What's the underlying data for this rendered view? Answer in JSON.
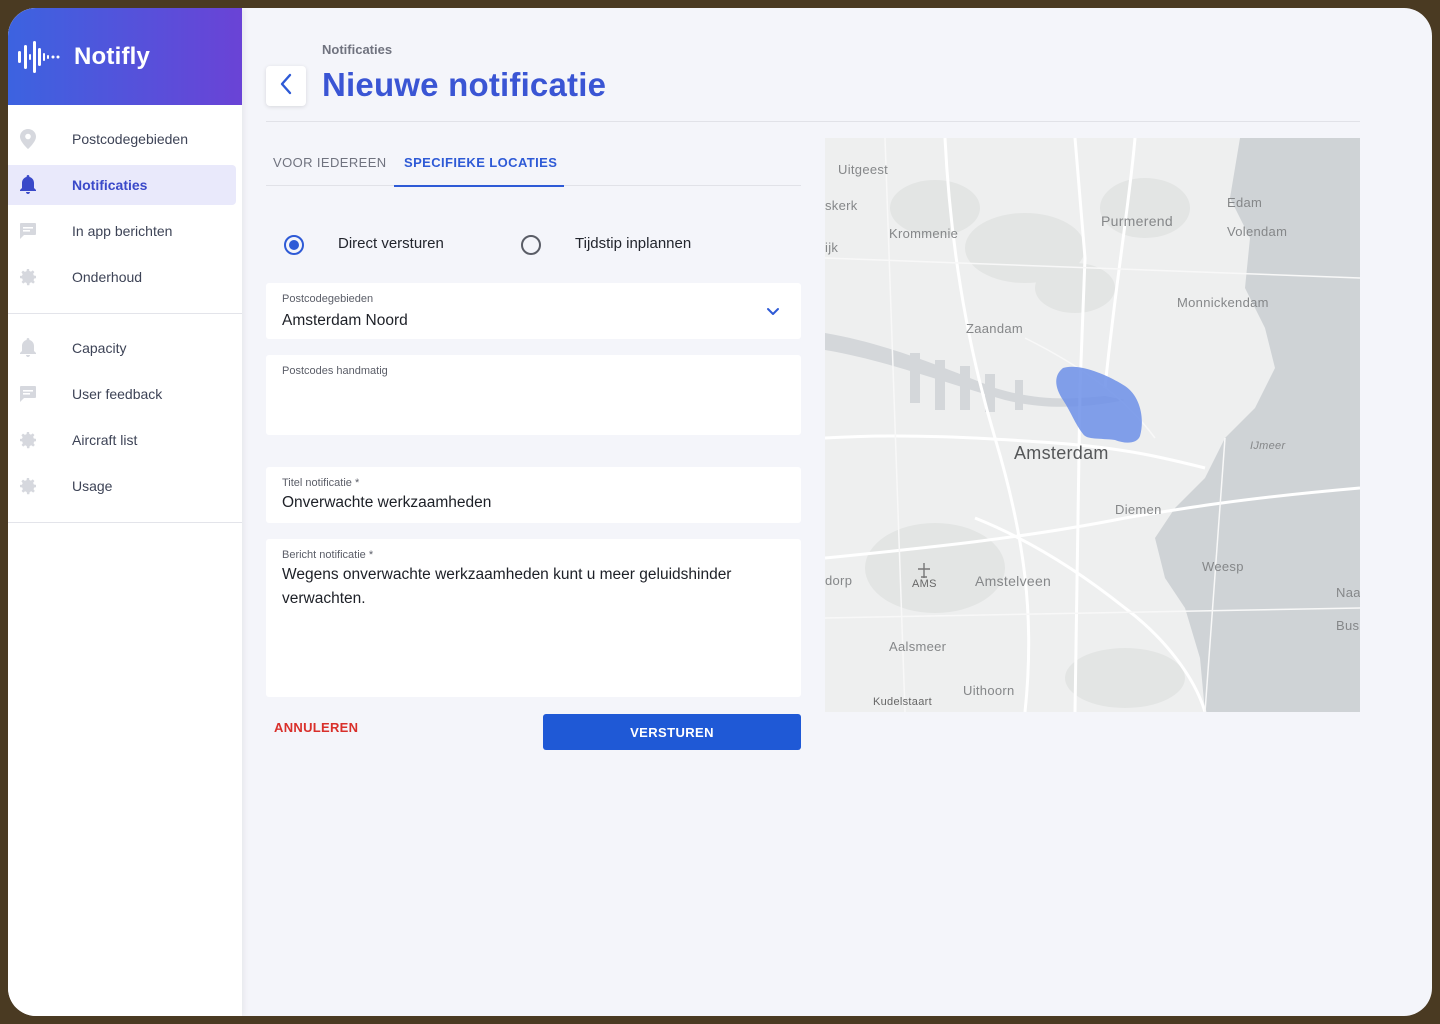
{
  "brand": {
    "name": "Notifly"
  },
  "sidebar": {
    "group1": [
      {
        "label": "Postcodegebieden",
        "icon": "location-pin-icon",
        "active": false
      },
      {
        "label": "Notificaties",
        "icon": "bell-icon",
        "active": true
      },
      {
        "label": "In app berichten",
        "icon": "chat-icon",
        "active": false
      },
      {
        "label": "Onderhoud",
        "icon": "gear-icon",
        "active": false
      }
    ],
    "group2": [
      {
        "label": "Capacity",
        "icon": "bell-icon",
        "active": false
      },
      {
        "label": "User feedback",
        "icon": "chat-icon",
        "active": false
      },
      {
        "label": "Aircraft list",
        "icon": "gear-icon",
        "active": false
      },
      {
        "label": "Usage",
        "icon": "gear-icon",
        "active": false
      }
    ]
  },
  "header": {
    "breadcrumb": "Notificaties",
    "title": "Nieuwe notificatie"
  },
  "tabs": [
    {
      "label": "VOOR IEDEREEN",
      "active": false
    },
    {
      "label": "SPECIFIEKE LOCATIES",
      "active": true
    }
  ],
  "send_mode": {
    "options": [
      {
        "label": "Direct versturen",
        "selected": true
      },
      {
        "label": "Tijdstip inplannen",
        "selected": false
      }
    ]
  },
  "form": {
    "postcode_areas": {
      "label": "Postcodegebieden",
      "value": "Amsterdam Noord"
    },
    "postcodes_manual": {
      "label": "Postcodes handmatig",
      "value": ""
    },
    "title": {
      "label": "Titel notificatie *",
      "value": "Onverwachte werkzaamheden"
    },
    "message": {
      "label": "Bericht notificatie *",
      "value": "Wegens onverwachte werkzaamheden kunt u meer geluidshinder verwachten."
    }
  },
  "actions": {
    "cancel": "ANNULEREN",
    "send": "VERSTUREN"
  },
  "map": {
    "places": [
      "Uitgeest",
      "skerk",
      "Krommenie",
      "Purmerend",
      "Edam",
      "Volendam",
      "ijk",
      "Monnickendam",
      "Zaandam",
      "Amsterdam",
      "IJmeer",
      "Diemen",
      "dorp",
      "AMS",
      "Amstelveen",
      "Weesp",
      "Naa",
      "Bus",
      "Aalsmeer",
      "Uithoorn",
      "Kudelstaart"
    ],
    "highlight_color": "#6c8fe8",
    "water_color": "#cfd3d6"
  },
  "colors": {
    "accent": "#2e5ad6",
    "danger": "#d9302b",
    "brand_from": "#3c63e0",
    "brand_to": "#6a43d6"
  }
}
